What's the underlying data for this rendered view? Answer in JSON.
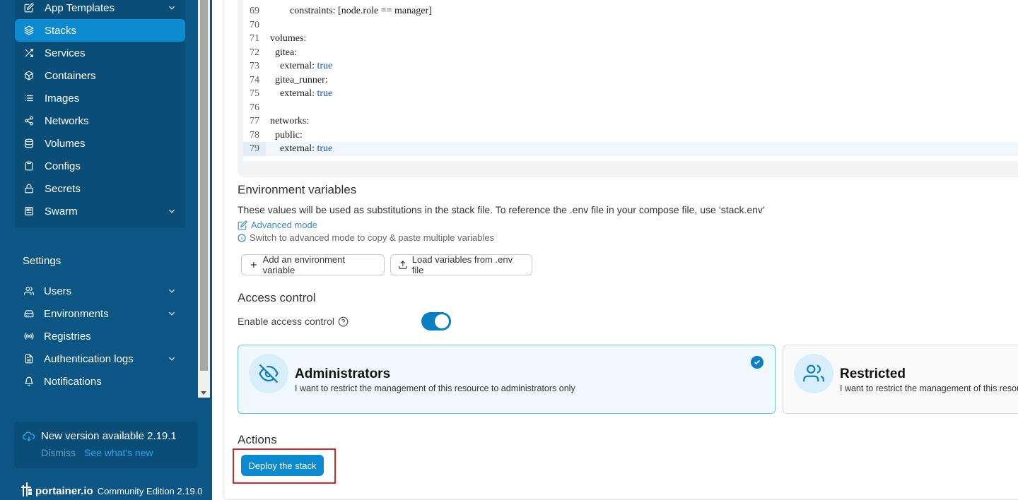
{
  "sidebar": {
    "nav_items": [
      {
        "label": "App Templates",
        "icon": "edit-icon",
        "expandable": true
      },
      {
        "label": "Stacks",
        "icon": "layers-icon",
        "active": true
      },
      {
        "label": "Services",
        "icon": "shuffle-icon"
      },
      {
        "label": "Containers",
        "icon": "box-icon"
      },
      {
        "label": "Images",
        "icon": "list-icon"
      },
      {
        "label": "Networks",
        "icon": "share-icon"
      },
      {
        "label": "Volumes",
        "icon": "database-icon"
      },
      {
        "label": "Configs",
        "icon": "clipboard-icon"
      },
      {
        "label": "Secrets",
        "icon": "lock-icon"
      },
      {
        "label": "Swarm",
        "icon": "grid-icon",
        "expandable": true
      }
    ],
    "settings_title": "Settings",
    "settings_items": [
      {
        "label": "Users",
        "icon": "users-icon",
        "expandable": true
      },
      {
        "label": "Environments",
        "icon": "hard-drive-icon",
        "expandable": true
      },
      {
        "label": "Registries",
        "icon": "radio-icon"
      },
      {
        "label": "Authentication logs",
        "icon": "file-text-icon",
        "expandable": true
      },
      {
        "label": "Notifications",
        "icon": "bell-icon"
      }
    ],
    "update": {
      "title": "New version available 2.19.1",
      "dismiss": "Dismiss",
      "whats_new": "See what's new"
    },
    "brand": {
      "logo": "portainer.io",
      "edition": "Community Edition 2.19.0"
    }
  },
  "editor": {
    "lines": [
      {
        "n": "69",
        "code": "        constraints: [node.role == manager]"
      },
      {
        "n": "70",
        "code": ""
      },
      {
        "n": "71",
        "code": "volumes:"
      },
      {
        "n": "72",
        "code": "  gitea:"
      },
      {
        "n": "73",
        "code": "    external: ",
        "kw": "true"
      },
      {
        "n": "74",
        "code": "  gitea_runner:"
      },
      {
        "n": "75",
        "code": "    external: ",
        "kw": "true"
      },
      {
        "n": "76",
        "code": ""
      },
      {
        "n": "77",
        "code": "networks:"
      },
      {
        "n": "78",
        "code": "  public:"
      },
      {
        "n": "79",
        "code": "    external: ",
        "kw": "true",
        "highlight": true
      }
    ]
  },
  "env": {
    "title": "Environment variables",
    "description": "These values will be used as substitutions in the stack file. To reference the .env file in your compose file, use ‘stack.env’",
    "advanced_mode": "Advanced mode",
    "hint": "Switch to advanced mode to copy & paste multiple variables",
    "add_button": "Add an environment variable",
    "load_button": "Load variables from .env file"
  },
  "access": {
    "title": "Access control",
    "enable_label": "Enable access control",
    "enabled": true,
    "admin_title": "Administrators",
    "admin_desc": "I want to restrict the management of this resource to administrators only",
    "restricted_title": "Restricted",
    "restricted_desc": "I want to restrict the management of this resource to a set of users and/or teams"
  },
  "actions": {
    "title": "Actions",
    "deploy_label": "Deploy the stack"
  },
  "colors": {
    "sidebar_bg": "#0b5685",
    "accent": "#0b8ad0",
    "highlight_frame": "#d9262c"
  }
}
